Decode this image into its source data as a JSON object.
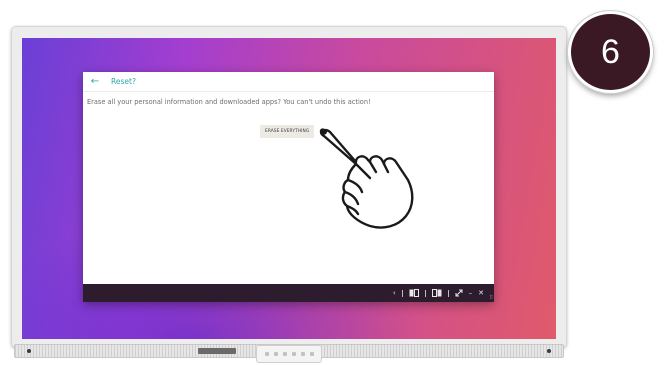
{
  "step_badge": {
    "number": "6"
  },
  "window": {
    "title": "Reset?",
    "message": "Erase all your personal information and downloaded apps? You can't undo this action!",
    "erase_button_label": "ERASE EVERYTHING"
  },
  "taskbar": {
    "icons": [
      "chevron-left-icon",
      "dock-left-icon",
      "dock-right-icon",
      "expand-icon",
      "minimize-icon",
      "close-icon"
    ],
    "minimize_glyph": "–",
    "close_glyph": "✕",
    "back_glyph": "‹"
  },
  "back_arrow_glyph": "←",
  "colors": {
    "accent_teal": "#2ea7a7",
    "taskbar_bg": "#2d1b2e",
    "badge_bg": "#3a1824",
    "button_bg": "#eceae3"
  }
}
